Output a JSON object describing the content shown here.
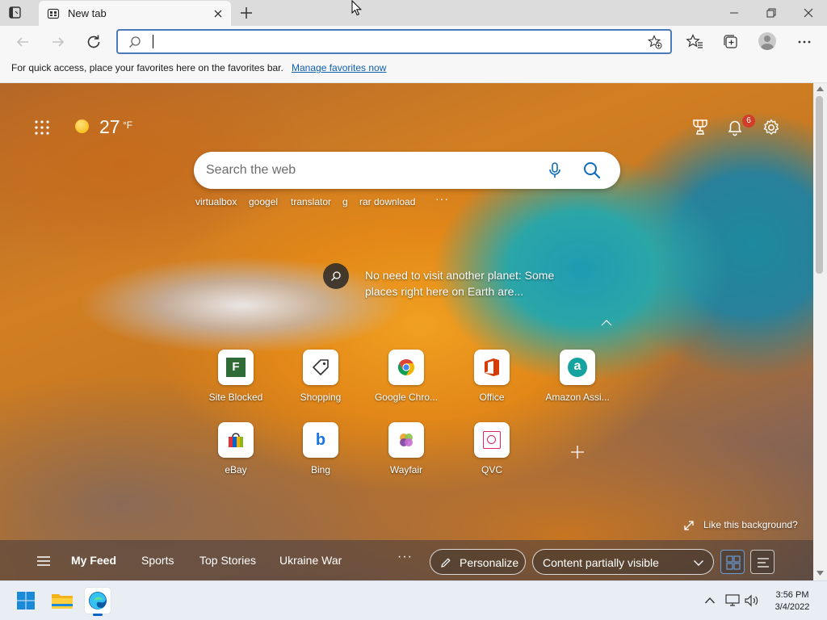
{
  "browser": {
    "tab_title": "New tab",
    "address_value": "",
    "favorites_bar_message": "For quick access, place your favorites here on the favorites bar.",
    "favorites_bar_link": "Manage favorites now"
  },
  "ntp": {
    "weather": {
      "temp": "27",
      "unit": "°F",
      "icon": "sun-icon"
    },
    "notification_count": "6",
    "search_placeholder": "Search the web",
    "suggestions": [
      "virtualbox",
      "googel",
      "translator",
      "g",
      "rar download"
    ],
    "more_dots": "···",
    "story_text": "No need to visit another planet: Some places right here on Earth are...",
    "tiles_row1": [
      {
        "label": "Site Blocked",
        "icon": "site-blocked-icon"
      },
      {
        "label": "Shopping",
        "icon": "shopping-tag-icon"
      },
      {
        "label": "Google Chro...",
        "icon": "chrome-icon"
      },
      {
        "label": "Office",
        "icon": "office-icon"
      },
      {
        "label": "Amazon Assi...",
        "icon": "amazon-icon"
      }
    ],
    "tiles_row2": [
      {
        "label": "eBay",
        "icon": "ebay-icon"
      },
      {
        "label": "Bing",
        "icon": "bing-icon"
      },
      {
        "label": "Wayfair",
        "icon": "wayfair-icon"
      },
      {
        "label": "QVC",
        "icon": "qvc-icon"
      }
    ],
    "like_background": "Like this background?",
    "feed": {
      "tabs": [
        "My Feed",
        "Sports",
        "Top Stories",
        "Ukraine War"
      ],
      "more": "···",
      "personalize": "Personalize",
      "content_visibility": "Content partially visible"
    }
  },
  "taskbar": {
    "time": "3:56 PM",
    "date": "3/4/2022"
  },
  "colors": {
    "accent": "#0a63c9",
    "address_border": "#4a7ab8",
    "badge": "#d13d2a",
    "link": "#0f5fb0"
  }
}
